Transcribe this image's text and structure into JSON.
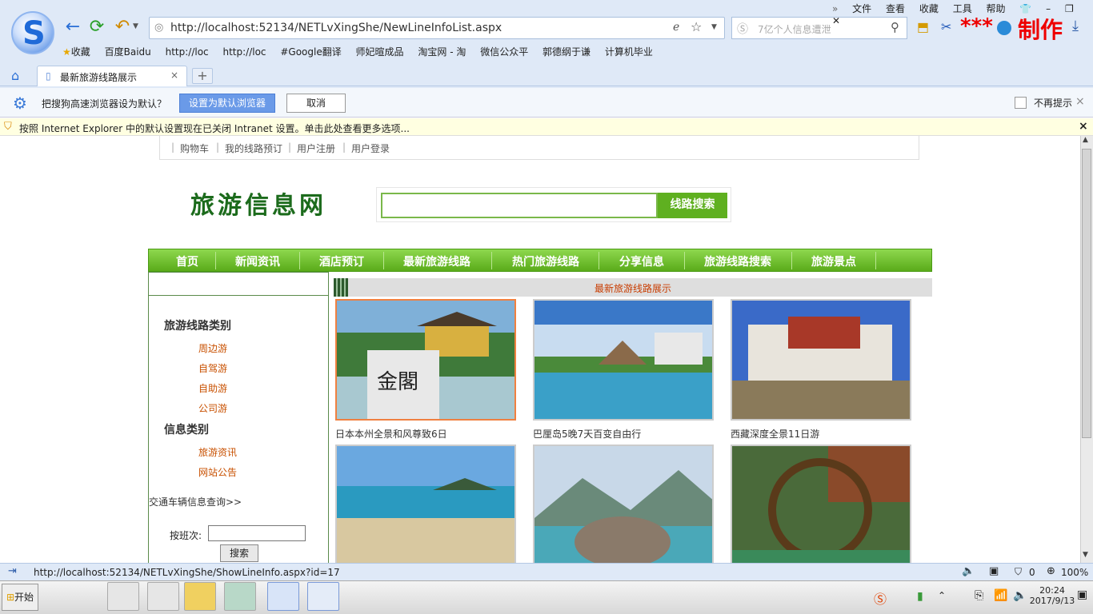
{
  "browser": {
    "menu": [
      "文件",
      "查看",
      "收藏",
      "工具",
      "帮助"
    ],
    "url": "http://localhost:52134/NETLvXingShe/NewLineInfoList.aspx",
    "search_placeholder": "7亿个人信息遭泄",
    "branding_stars": "***",
    "branding_text": "制作",
    "favorites": [
      "收藏",
      "百度Baidu",
      "http://loc",
      "http://loc",
      "#Google翻译",
      "师妃暄成品",
      "淘宝网 - 淘",
      "微信公众平",
      "郭德纲于谦",
      "计算机毕业"
    ],
    "tab_title": "最新旅游线路展示",
    "tab_close": "×",
    "new_tab": "+",
    "default_prompt": {
      "text": "把搜狗高速浏览器设为默认？",
      "set_default": "设置为默认浏览器",
      "cancel": "取消",
      "dont_show": "不再提示",
      "close": "×"
    },
    "ie_info": {
      "text": "按照 Internet Explorer 中的默认设置现在已关闭 Intranet 设置。单击此处查看更多选项...",
      "close": "×"
    }
  },
  "page": {
    "top_links": [
      "购物车",
      "我的线路预订",
      "用户注册",
      "用户登录"
    ],
    "site_title": "旅游信息网",
    "search_button": "线路搜索",
    "nav": [
      "首页",
      "新闻资讯",
      "酒店预订",
      "最新旅游线路",
      "热门旅游线路",
      "分享信息",
      "旅游线路搜索",
      "旅游景点"
    ],
    "sidebar": {
      "cat1": "旅游线路类别",
      "cat1_items": [
        "周边游",
        "自驾游",
        "自助游",
        "公司游"
      ],
      "cat2": "信息类别",
      "cat2_items": [
        "旅游资讯",
        "网站公告"
      ],
      "traffic": "交通车辆信息查询>>",
      "ban_label": "按班次:",
      "ban_button": "搜索"
    },
    "section_title": "最新旅游线路展示",
    "lines": [
      {
        "name": "日本本州全景和风尊致6日"
      },
      {
        "name": "巴厘岛5晚7天百变自由行"
      },
      {
        "name": "西藏深度全景11日游"
      },
      {
        "name": ""
      },
      {
        "name": ""
      },
      {
        "name": ""
      }
    ]
  },
  "status": {
    "url": "http://localhost:52134/NETLvXingShe/ShowLineInfo.aspx?id=17",
    "shield_count": "0",
    "zoom": "100%"
  },
  "taskbar": {
    "start": "开始",
    "time": "20:24",
    "date": "2017/9/13"
  }
}
